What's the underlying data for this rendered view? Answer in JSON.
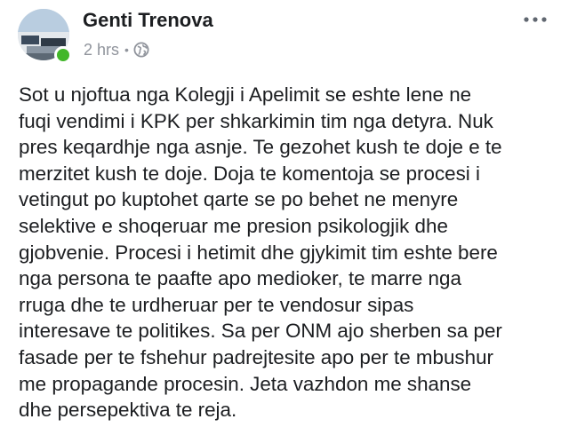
{
  "post": {
    "author": "Genti Trenova",
    "timestamp": "2 hrs",
    "separator": "•",
    "audience_icon": "globe-icon",
    "more_icon": "more-options-icon",
    "online_status_color": "#42b72a",
    "text": "Sot u njoftua nga Kolegji i Apelimit se eshte lene ne\nfuqi vendimi i KPK per shkarkimin tim nga detyra. Nuk\npres keqardhje nga asnje. Te gezohet kush  te doje e te\nmerzitet kush te doje. Doja te komentoja se procesi i\nvetingut po kuptohet qarte se po behet ne menyre\nselektive e shoqeruar me presion  psikologjik dhe\ngjobvenie. Procesi i hetimit dhe gjykimit tim eshte bere\nnga persona te paafte apo  medioker, te marre nga\nrruga dhe te urdheruar per te vendosur sipas\ninteresave te politikes. Sa per ONM ajo sherben sa per\nfasade per te  fshehur padrejtesite apo per te mbushur\nme propagande procesin. Jeta vazhdon me shanse\ndhe persepektiva te reja."
  },
  "colors": {
    "text_primary": "#1c1e21",
    "text_secondary": "#90949c",
    "background": "#ffffff"
  }
}
